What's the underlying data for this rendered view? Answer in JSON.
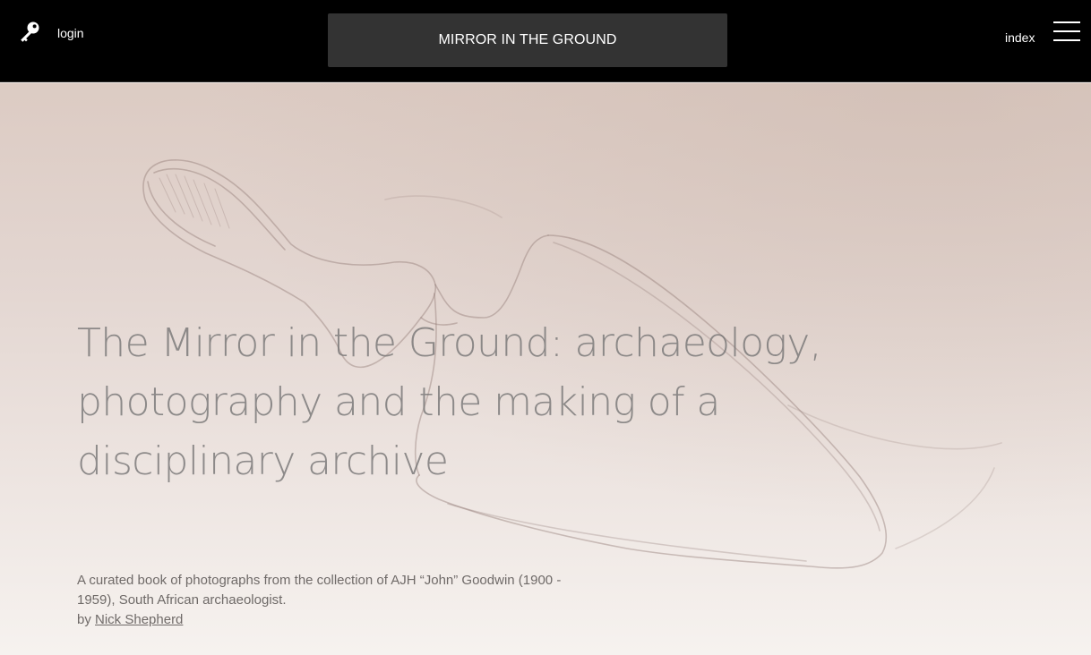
{
  "header": {
    "login_label": "login",
    "site_title": "MIRROR IN THE GROUND",
    "index_label": "index",
    "icons": {
      "login": "key-icon",
      "menu": "hamburger-menu-icon"
    }
  },
  "hero": {
    "title": "The Mirror in the Ground: archaeology, photography and the making of a disciplinary archive",
    "description": "A curated book of photographs from the collection of AJH “John” Goodwin (1900 - 1959), South African archaeologist.",
    "byline_prefix": "by",
    "author_name": "Nick Shepherd",
    "background_illustration": "pencil sketch of a trowel"
  },
  "colors": {
    "header_background": "#000000",
    "title_box_background": "#333333",
    "hero_text": "#7a7878"
  }
}
